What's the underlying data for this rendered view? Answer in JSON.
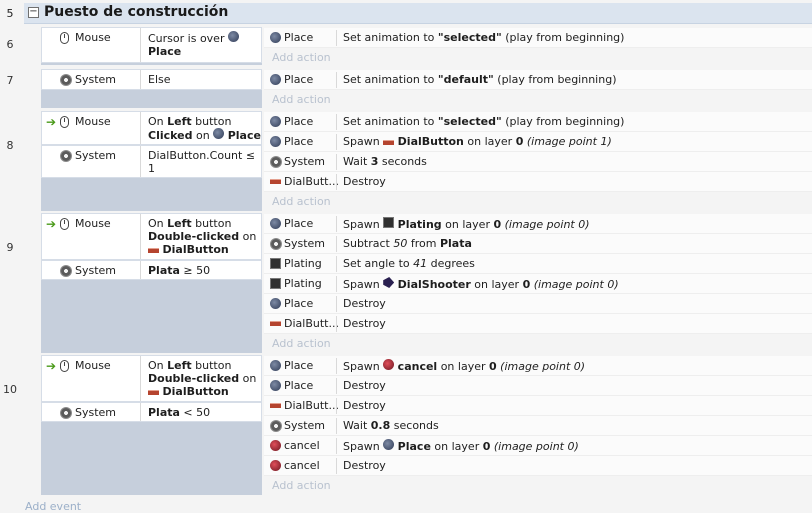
{
  "group": {
    "title": "Puesto de construcción",
    "collapse_symbol": "−"
  },
  "events": [
    {
      "number": "6"
    },
    {
      "number": "7"
    },
    {
      "number": "8"
    },
    {
      "number": "9"
    },
    {
      "number": "10"
    }
  ],
  "labels": {
    "mouse": "Mouse",
    "system": "System",
    "place": "Place",
    "plating": "Plating",
    "dialbutton": "DialButt...",
    "cancel": "cancel",
    "add_action": "Add action",
    "add_event": "Add event"
  },
  "e6": {
    "cond_text": "Cursor is over",
    "cond_obj": "Place",
    "act1": [
      "Set animation to ",
      "\"selected\"",
      " (play from beginning)"
    ]
  },
  "e7": {
    "cond_text": "Else",
    "act1": [
      "Set animation to ",
      "\"default\"",
      " (play from beginning)"
    ]
  },
  "e8": {
    "cond1": [
      "On ",
      "Left",
      " button"
    ],
    "cond1b": [
      "Clicked",
      " on "
    ],
    "cond1_obj": "Place",
    "cond2": "DialButton.Count ≤",
    "cond2b": "1",
    "act1": [
      "Set animation to ",
      "\"selected\"",
      " (play from beginning)"
    ],
    "act2": [
      "Spawn ",
      "DialButton",
      " on layer ",
      "0",
      " ",
      "(image point 1)"
    ],
    "act3": [
      "Wait ",
      "3",
      " seconds"
    ],
    "act4": "Destroy"
  },
  "e9": {
    "cond1": [
      "On ",
      "Left",
      " button"
    ],
    "cond1b": [
      "Double-clicked",
      " on"
    ],
    "cond1_obj": "DialButton",
    "cond2": [
      "Plata",
      " ≥ 50"
    ],
    "act1": [
      "Spawn ",
      "Plating",
      " on layer ",
      "0",
      " ",
      "(image point 0)"
    ],
    "act2": [
      "Subtract ",
      "50",
      " from ",
      "Plata"
    ],
    "act3": [
      "Set angle to ",
      "41",
      " degrees"
    ],
    "act4": [
      "Spawn ",
      "DialShooter",
      " on layer ",
      "0",
      " ",
      "(image point 0)"
    ],
    "act5": "Destroy",
    "act6": "Destroy"
  },
  "e10": {
    "cond1": [
      "On ",
      "Left",
      " button"
    ],
    "cond1b": [
      "Double-clicked",
      " on"
    ],
    "cond1_obj": "DialButton",
    "cond2": [
      "Plata",
      " < 50"
    ],
    "act1": [
      "Spawn ",
      "cancel",
      " on layer ",
      "0",
      " ",
      "(image point 0)"
    ],
    "act2": "Destroy",
    "act3": "Destroy",
    "act4": [
      "Wait ",
      "0.8",
      " seconds"
    ],
    "act5": [
      "Spawn ",
      "Place",
      " on layer ",
      "0",
      " ",
      "(image point 0)"
    ],
    "act6": "Destroy"
  }
}
